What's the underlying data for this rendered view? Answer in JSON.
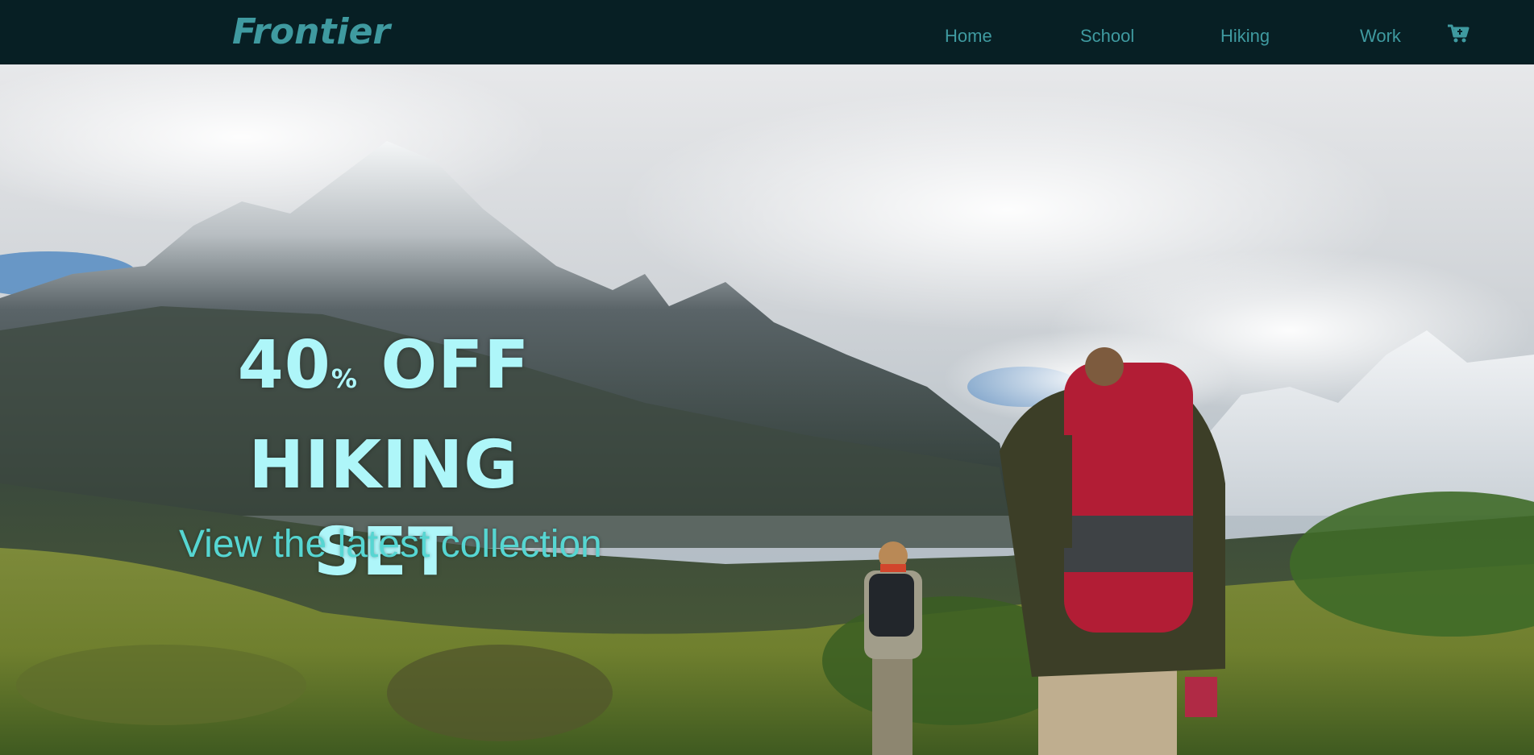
{
  "nav": {
    "logo": "Frontier",
    "links": [
      {
        "label": "Home"
      },
      {
        "label": "School"
      },
      {
        "label": "Hiking"
      },
      {
        "label": "Work"
      }
    ],
    "cart_icon": "cart-icon"
  },
  "hero": {
    "headline_number": "40",
    "headline_percent": "%",
    "headline_off": " OFF",
    "headline_line2": "HIKING",
    "headline_line3": "SET",
    "subheadline": "View the latest collection",
    "background": "photo-mountains-hikers"
  },
  "colors": {
    "navbar_bg": "#071f24",
    "nav_text": "#3f9aa0",
    "headline": "#aef6f9",
    "subheadline": "#56d6d2"
  }
}
